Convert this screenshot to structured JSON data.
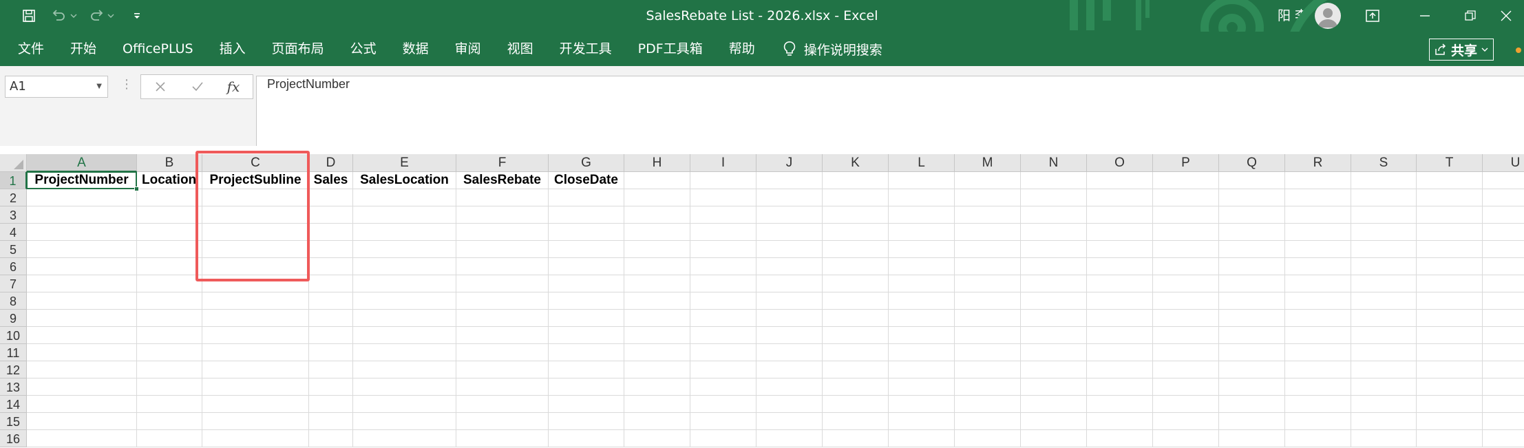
{
  "window": {
    "title": "SalesRebate List - 2026.xlsx  -  Excel",
    "user_name": "阳 李",
    "brand_color": "#217346",
    "highlight_color": "#ef5a5a"
  },
  "quick_access": {
    "icons": [
      "save-icon",
      "undo-icon",
      "redo-icon",
      "customize-qat-icon"
    ]
  },
  "ribbon": {
    "tabs": [
      "文件",
      "开始",
      "OfficePLUS",
      "插入",
      "页面布局",
      "公式",
      "数据",
      "审阅",
      "视图",
      "开发工具",
      "PDF工具箱",
      "帮助"
    ],
    "tell_me": "操作说明搜索",
    "share_label": "共享"
  },
  "formula_bar": {
    "name_box": "A1",
    "formula": "ProjectNumber"
  },
  "sheet": {
    "columns": [
      "A",
      "B",
      "C",
      "D",
      "E",
      "F",
      "G",
      "H",
      "I",
      "J",
      "K",
      "L",
      "M",
      "N",
      "O",
      "P",
      "Q",
      "R",
      "S",
      "T",
      "U"
    ],
    "rows": [
      "1",
      "2",
      "3",
      "4",
      "5",
      "6",
      "7",
      "8",
      "9",
      "10",
      "11",
      "12",
      "13",
      "14",
      "15",
      "16"
    ],
    "header_cells": [
      "ProjectNumber",
      "Location",
      "ProjectSubline",
      "Sales",
      "SalesLocation",
      "SalesRebate",
      "CloseDate"
    ],
    "active_cell": "A1"
  }
}
